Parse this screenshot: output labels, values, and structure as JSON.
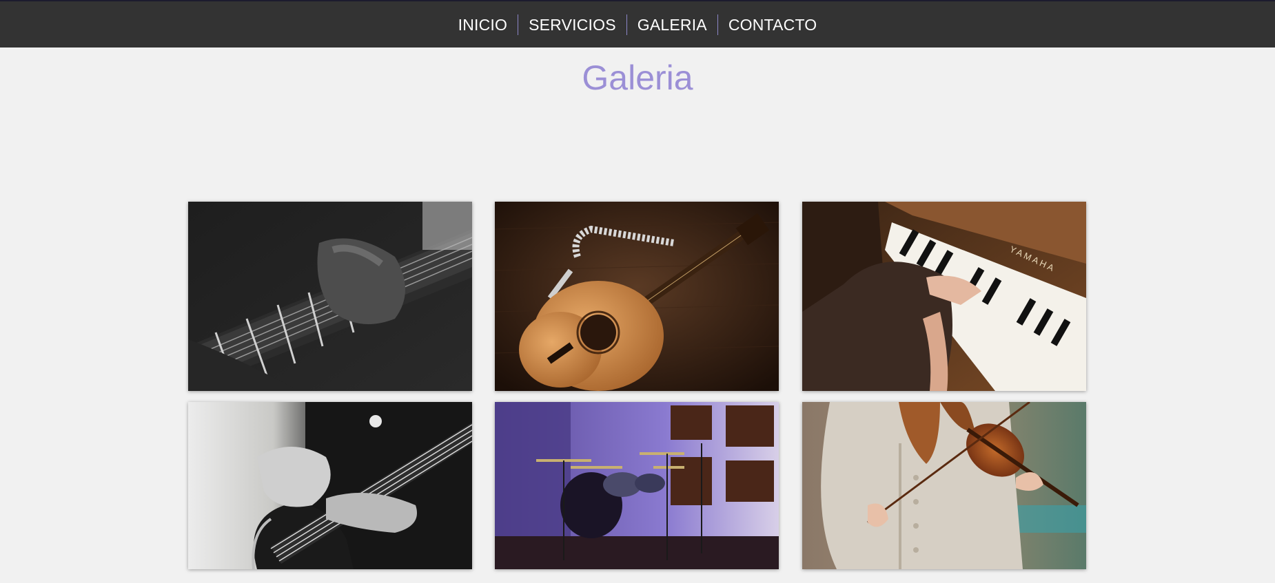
{
  "nav": {
    "items": [
      {
        "label": "INICIO"
      },
      {
        "label": "SERVICIOS"
      },
      {
        "label": "GALERIA"
      },
      {
        "label": "CONTACTO"
      }
    ],
    "bg_color": "#333333",
    "separator_color": "#8c86c8"
  },
  "page": {
    "title": "Galeria",
    "title_color": "#9b8fd6",
    "background": "#f1f1f1"
  },
  "gallery": {
    "images": [
      {
        "name": "electric-guitar-bw-photo"
      },
      {
        "name": "acoustic-guitar-photo"
      },
      {
        "name": "piano-photo"
      },
      {
        "name": "bass-guitar-photo"
      },
      {
        "name": "drum-kit-photo"
      },
      {
        "name": "violin-photo"
      }
    ]
  }
}
